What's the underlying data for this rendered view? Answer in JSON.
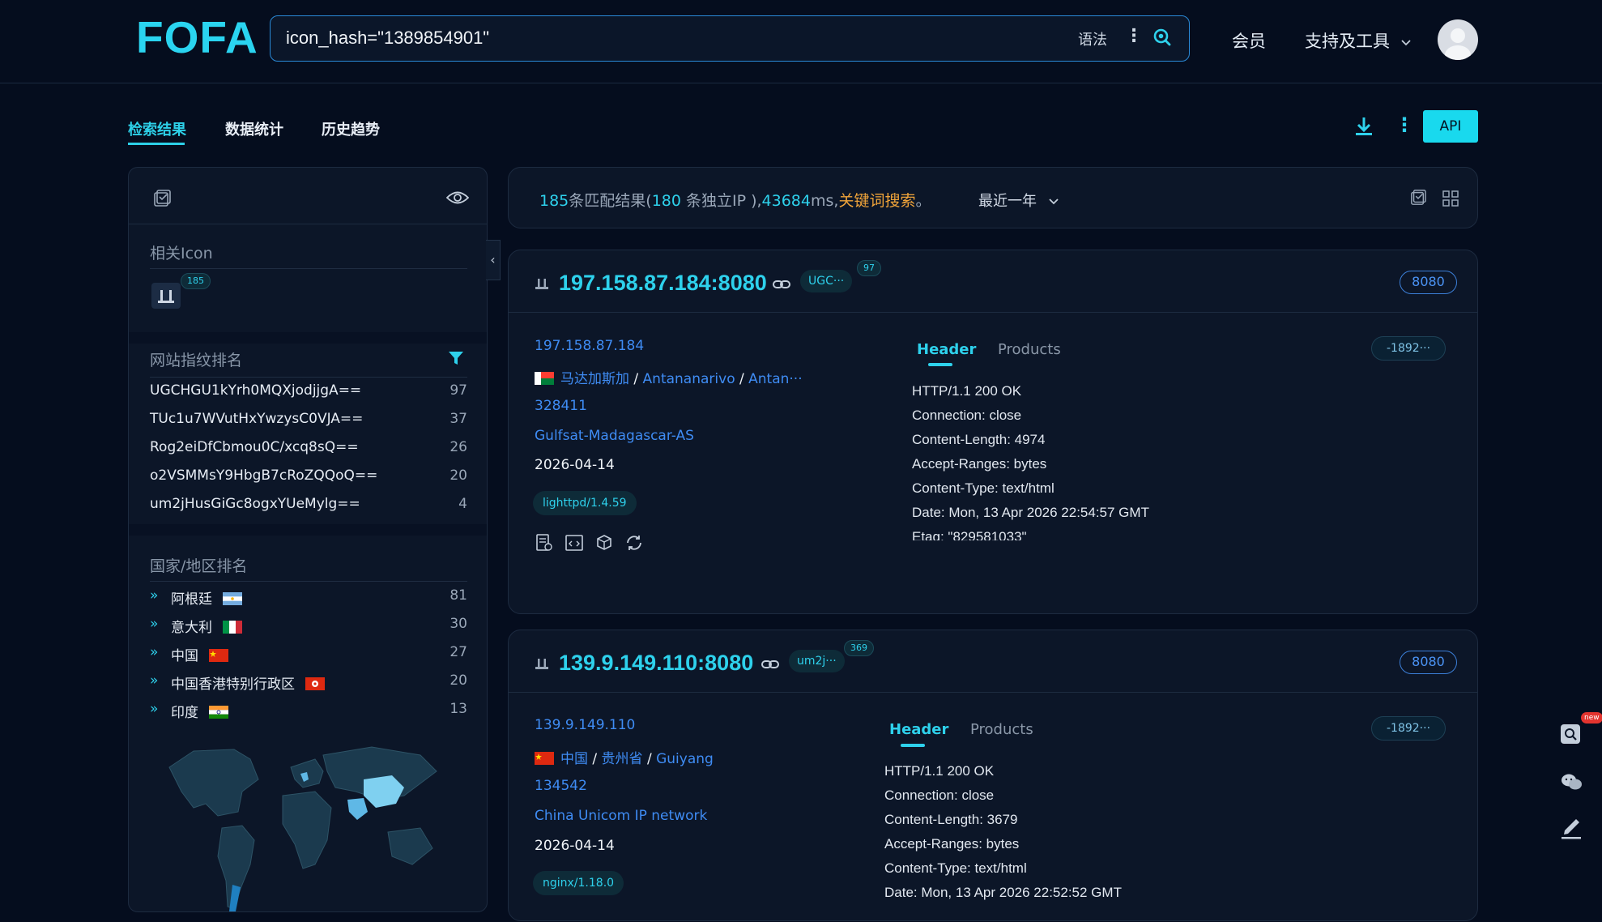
{
  "logo": "FOFA",
  "search": {
    "query": "icon_hash=\"1389854901\"",
    "syntax": "语法"
  },
  "nav": {
    "member": "会员",
    "tools": "支持及工具"
  },
  "tabs": [
    "检索结果",
    "数据统计",
    "历史趋势"
  ],
  "api": "API",
  "left": {
    "icon_title": "相关Icon",
    "icon_count": "185",
    "fp_title": "网站指纹排名",
    "fingerprints": [
      {
        "name": "UGCHGU1kYrh0MQXjodjjgA==",
        "count": "97"
      },
      {
        "name": "TUc1u7WVutHxYwzysC0VJA==",
        "count": "37"
      },
      {
        "name": "Rog2eiDfCbmou0C/xcq8sQ==",
        "count": "26"
      },
      {
        "name": "o2VSMMsY9HbgB7cRoZQQoQ==",
        "count": "20"
      },
      {
        "name": "um2jHusGiGc8ogxYUeMylg==",
        "count": "4"
      }
    ],
    "country_title": "国家/地区排名",
    "countries": [
      {
        "name": "阿根廷",
        "count": "81",
        "flag": "ar"
      },
      {
        "name": "意大利",
        "count": "30",
        "flag": "it"
      },
      {
        "name": "中国",
        "count": "27",
        "flag": "cn"
      },
      {
        "name": "中国香港特别行政区",
        "count": "20",
        "flag": "hk"
      },
      {
        "name": "印度",
        "count": "13",
        "flag": "in"
      }
    ]
  },
  "summary": {
    "matches": "185",
    "t1": "条匹配结果(",
    "unique": "180",
    "t2": " 条独立IP ),",
    "ms": "43684",
    "t3": "ms,",
    "kw": "关键词搜索",
    "t4": "。",
    "range": "最近一年"
  },
  "results": [
    {
      "title": "197.158.87.184:8080",
      "tag": "UGC···",
      "tag_count": "97",
      "port": "8080",
      "ip": "197.158.87.184",
      "country": "马达加斯加",
      "region": "Antananarivo",
      "city": "Antan···",
      "asn": "328411",
      "org": "Gulfsat-Madagascar-AS",
      "date": "2026-04-14",
      "product": "lighttpd/1.4.59",
      "hash": "-1892···",
      "header_tab": "Header",
      "products_tab": "Products",
      "headers": [
        "HTTP/1.1 200 OK",
        "Connection: close",
        "Content-Length: 4974",
        "Accept-Ranges: bytes",
        "Content-Type: text/html",
        "Date: Mon, 13 Apr 2026 22:54:57 GMT",
        "Etag: \"829581033\""
      ]
    },
    {
      "title": "139.9.149.110:8080",
      "tag": "um2j···",
      "tag_count": "369",
      "port": "8080",
      "ip": "139.9.149.110",
      "country": "中国",
      "region": "贵州省",
      "city": "Guiyang",
      "asn": "134542",
      "org": "China Unicom IP network",
      "date": "2026-04-14",
      "product": "nginx/1.18.0",
      "hash": "-1892···",
      "header_tab": "Header",
      "products_tab": "Products",
      "headers": [
        "HTTP/1.1 200 OK",
        "Connection: close",
        "Content-Length: 3679",
        "Accept-Ranges: bytes",
        "Content-Type: text/html",
        "Date: Mon, 13 Apr 2026 22:52:52 GMT"
      ]
    }
  ],
  "dock": {
    "new": "new"
  }
}
